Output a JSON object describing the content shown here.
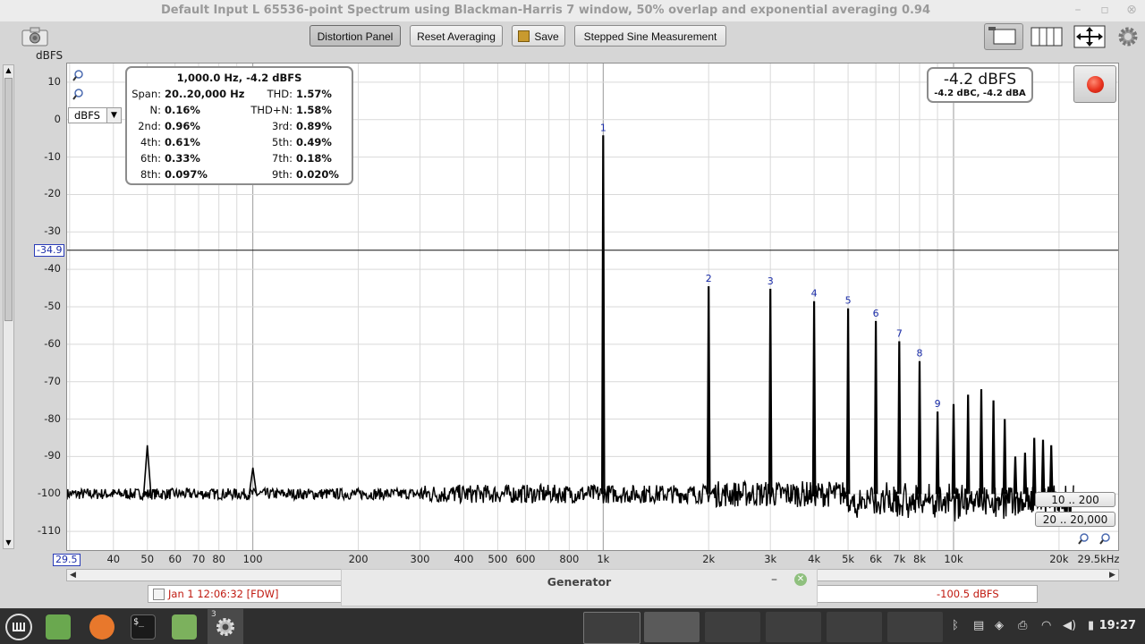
{
  "window": {
    "title": "Default Input L 65536-point Spectrum using Blackman-Harris 7 window, 50% overlap and exponential averaging 0.94"
  },
  "toolbar": {
    "distortion_panel": "Distortion Panel",
    "reset_averaging": "Reset Averaging",
    "save": "Save",
    "stepped_sine": "Stepped Sine Measurement"
  },
  "plot": {
    "y_unit": "dBFS",
    "unit_select": "dBFS",
    "y_ticks": [
      "10",
      "0",
      "-10",
      "-20",
      "-30",
      "-40",
      "-50",
      "-60",
      "-70",
      "-80",
      "-90",
      "-100",
      "-110"
    ],
    "x_ticks": [
      "40",
      "50",
      "60",
      "70",
      "80",
      "100",
      "200",
      "300",
      "400",
      "500",
      "600",
      "800",
      "1k",
      "2k",
      "3k",
      "4k",
      "5k",
      "6k",
      "7k",
      "8k",
      "10k",
      "20k",
      "29.5kHz"
    ],
    "x_min_tag": "29.5",
    "cursor_level": "-34.9",
    "harmonic_markers": [
      "1",
      "2",
      "3",
      "4",
      "5",
      "6",
      "7",
      "8",
      "9"
    ],
    "range_buttons": {
      "y_range": "10 .. 200",
      "x_range": "20 .. 20,000"
    }
  },
  "distortion": {
    "header": "1,000.0 Hz, -4.2 dBFS",
    "rows": [
      {
        "k1": "Span:",
        "v1": "20..20,000 Hz",
        "k2": "THD:",
        "v2": "1.57%"
      },
      {
        "k1": "N:",
        "v1": "0.16%",
        "k2": "THD+N:",
        "v2": "1.58%"
      },
      {
        "k1": "2nd:",
        "v1": "0.96%",
        "k2": "3rd:",
        "v2": "0.89%"
      },
      {
        "k1": "4th:",
        "v1": "0.61%",
        "k2": "5th:",
        "v2": "0.49%"
      },
      {
        "k1": "6th:",
        "v1": "0.33%",
        "k2": "7th:",
        "v2": "0.18%"
      },
      {
        "k1": "8th:",
        "v1": "0.097%",
        "k2": "9th:",
        "v2": "0.020%"
      }
    ]
  },
  "level": {
    "main": "-4.2 dBFS",
    "sub": "-4.2 dBC, -4.2 dBA"
  },
  "status": {
    "left": "Jan 1 12:06:32 [FDW]",
    "right": "-100.5 dBFS"
  },
  "generator": {
    "title": "Generator"
  },
  "taskbar": {
    "badge": "3",
    "clock": "19:27"
  },
  "colors": {
    "marker_blue": "#1a2ca8",
    "record_red": "#e8321e",
    "grid": "#d9d9d9"
  },
  "chart_data": {
    "type": "line",
    "xscale": "log",
    "xlim": [
      29.5,
      29500
    ],
    "ylim": [
      -115,
      15
    ],
    "ylabel": "dBFS",
    "noise_floor": -100,
    "peaks": [
      {
        "label": "",
        "x": 50,
        "y": -87
      },
      {
        "label": "",
        "x": 100,
        "y": -93
      },
      {
        "label": "1",
        "x": 1000,
        "y": -4.2
      },
      {
        "label": "2",
        "x": 2000,
        "y": -44.5
      },
      {
        "label": "3",
        "x": 3000,
        "y": -45.2
      },
      {
        "label": "4",
        "x": 4000,
        "y": -48.5
      },
      {
        "label": "5",
        "x": 5000,
        "y": -50.4
      },
      {
        "label": "6",
        "x": 6000,
        "y": -53.8
      },
      {
        "label": "7",
        "x": 7000,
        "y": -59.2
      },
      {
        "label": "8",
        "x": 8000,
        "y": -64.5
      },
      {
        "label": "9",
        "x": 9000,
        "y": -78
      },
      {
        "label": "",
        "x": 10000,
        "y": -76
      },
      {
        "label": "",
        "x": 11000,
        "y": -73.5
      },
      {
        "label": "",
        "x": 12000,
        "y": -72
      },
      {
        "label": "",
        "x": 13000,
        "y": -75
      },
      {
        "label": "",
        "x": 14000,
        "y": -80
      },
      {
        "label": "",
        "x": 15000,
        "y": -90
      },
      {
        "label": "",
        "x": 16000,
        "y": -89
      },
      {
        "label": "",
        "x": 17000,
        "y": -85
      },
      {
        "label": "",
        "x": 18000,
        "y": -85.5
      },
      {
        "label": "",
        "x": 19000,
        "y": -87
      }
    ]
  }
}
